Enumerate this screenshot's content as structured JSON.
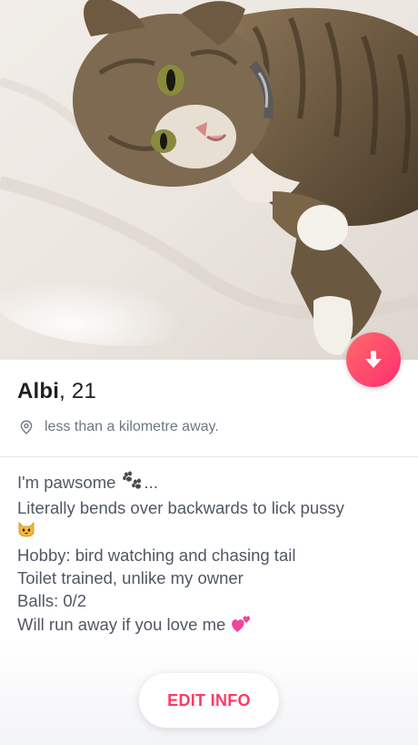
{
  "profile": {
    "name": "Albi",
    "age_separator": ", ",
    "age": "21",
    "distance": "less than a kilometre away."
  },
  "bio": {
    "line1": "I'm pawsome ",
    "line1_suffix": "...",
    "line2": "Literally bends over backwards to lick pussy",
    "line4": "Hobby: bird watching and chasing tail",
    "line5": "Toilet trained, unlike my owner",
    "line6": "Balls: 0/2",
    "line7": "Will run away if you love me "
  },
  "actions": {
    "edit_label": "EDIT INFO"
  },
  "icons": {
    "collapse": "arrow-down-icon",
    "location": "location-pin-icon",
    "paws": "paw-prints-emoji",
    "cat": "cat-face-emoji",
    "heart": "two-hearts-emoji"
  },
  "colors": {
    "accent": "#fd3b63",
    "gradient_start": "#ff6a6a",
    "gradient_end": "#fd2f6e",
    "text_dark": "#1f1f1f",
    "text_muted": "#6e7685",
    "text_bio": "#505764"
  }
}
